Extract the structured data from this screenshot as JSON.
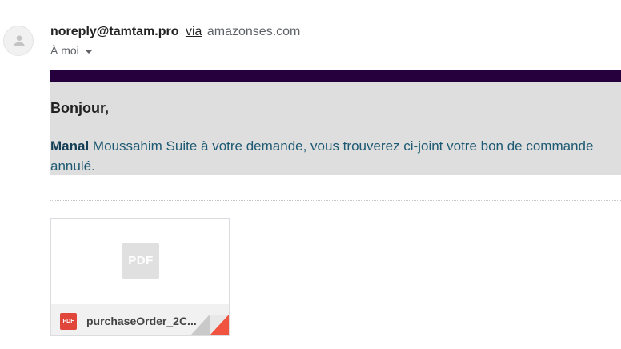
{
  "sender": {
    "email": "noreply@tamtam.pro",
    "via_label": "via",
    "domain": "amazonses.com"
  },
  "recipient": {
    "label": "À moi"
  },
  "email_body": {
    "greeting": "Bonjour,",
    "name_bold": "Manal",
    "message": " Moussahim Suite à votre demande, vous trouverez ci-joint votre bon de commande annulé."
  },
  "attachment": {
    "preview_icon_label": "PDF",
    "file_icon_label": "PDF",
    "file_name": "purchaseOrder_2C..."
  },
  "colors": {
    "header_bar": "#25003d",
    "body_background": "#dedede",
    "message_text": "#1e5a73",
    "pdf_red": "#e0463a"
  },
  "icons": {
    "avatar": "person-icon",
    "dropdown": "caret-down-icon",
    "preview": "pdf-icon",
    "file_type": "pdf-icon",
    "corner": "corner-fold-icon"
  }
}
